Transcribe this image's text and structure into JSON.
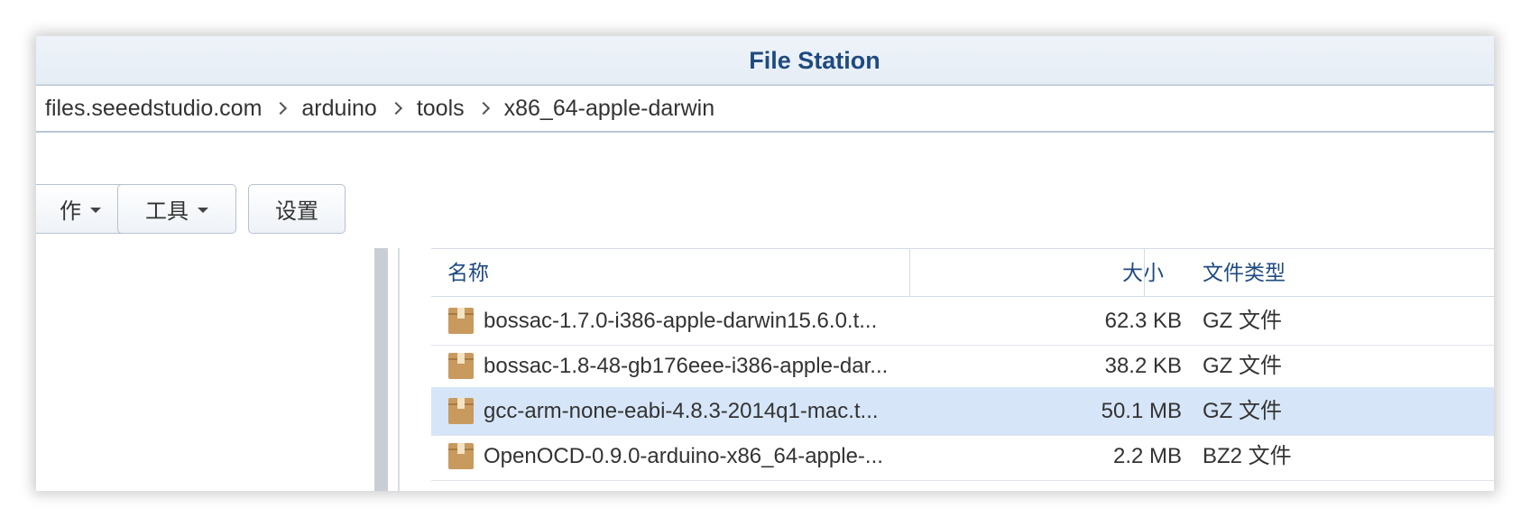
{
  "window": {
    "title": "File Station"
  },
  "breadcrumb": [
    "files.seeedstudio.com",
    "arduino",
    "tools",
    "x86_64-apple-darwin"
  ],
  "toolbar": {
    "action_label": "作",
    "tools_label": "工具",
    "settings_label": "设置"
  },
  "file_list": {
    "columns": {
      "name": "名称",
      "size": "大小",
      "type": "文件类型"
    },
    "rows": [
      {
        "name": "bossac-1.7.0-i386-apple-darwin15.6.0.t...",
        "size": "62.3 KB",
        "type": "GZ 文件",
        "icon": "package-icon",
        "selected": false
      },
      {
        "name": "bossac-1.8-48-gb176eee-i386-apple-dar...",
        "size": "38.2 KB",
        "type": "GZ 文件",
        "icon": "package-icon",
        "selected": false
      },
      {
        "name": "gcc-arm-none-eabi-4.8.3-2014q1-mac.t...",
        "size": "50.1 MB",
        "type": "GZ 文件",
        "icon": "package-icon",
        "selected": true
      },
      {
        "name": "OpenOCD-0.9.0-arduino-x86_64-apple-...",
        "size": "2.2 MB",
        "type": "BZ2 文件",
        "icon": "package-icon",
        "selected": false
      }
    ]
  },
  "colors": {
    "title": "#1f4a80",
    "header_text": "#1f4a80",
    "selected_row": "#d6e6f8",
    "package_icon": "#c89a5e"
  }
}
